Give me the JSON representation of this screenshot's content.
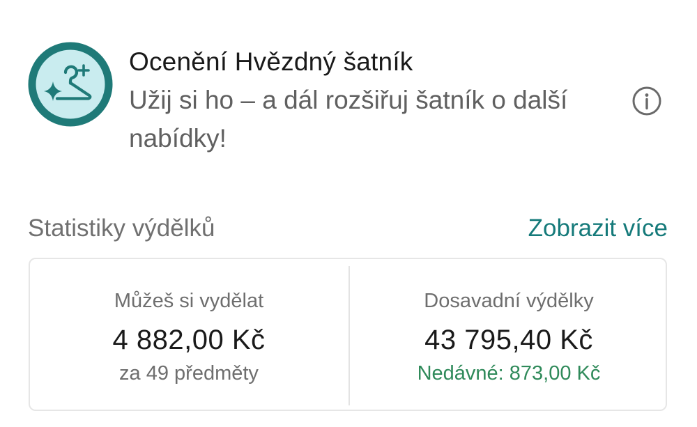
{
  "award": {
    "icon": "star-hanger-icon",
    "title": "Ocenění Hvězdný šatník",
    "subtitle": "Užij si ho – a dál rozšiřuj šatník o další nabídky!",
    "info_icon": "info-icon"
  },
  "stats": {
    "title": "Statistiky výdělků",
    "more_link": "Zobrazit více",
    "potential": {
      "label": "Můžeš si vydělat",
      "value": "4 882,00 Kč",
      "sub": "za 49 předměty"
    },
    "earned": {
      "label": "Dosavadní výdělky",
      "value": "43 795,40 Kč",
      "sub": "Nedávné: 873,00 Kč"
    }
  },
  "colors": {
    "brand_teal": "#157a7a",
    "badge_ring": "#1f7a78",
    "badge_fill": "#c9ecef",
    "recent_green": "#2f8a5a"
  }
}
